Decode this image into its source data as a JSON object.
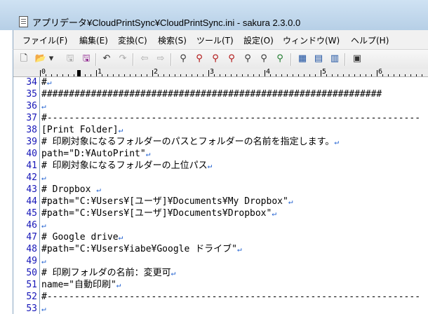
{
  "window": {
    "title": "アプリデータ¥CloudPrintSync¥CloudPrintSync.ini - sakura 2.3.0.0"
  },
  "menu": [
    {
      "label": "ファイル(F)"
    },
    {
      "label": "編集(E)"
    },
    {
      "label": "変換(C)"
    },
    {
      "label": "検索(S)"
    },
    {
      "label": "ツール(T)"
    },
    {
      "label": "設定(O)"
    },
    {
      "label": "ウィンドウ(W)"
    },
    {
      "label": "ヘルプ(H)"
    }
  ],
  "toolbar": {
    "buttons": [
      {
        "icon": "new-file-icon",
        "glyph": "🗋"
      },
      {
        "icon": "open-folder-icon",
        "glyph": "📂"
      },
      {
        "icon": "dropdown-arrow-icon",
        "glyph": "▾"
      },
      {
        "icon": "save-icon",
        "glyph": "🖫"
      },
      {
        "icon": "save-as-icon",
        "glyph": "🖫"
      },
      {
        "icon": "undo-icon",
        "glyph": "↶"
      },
      {
        "icon": "redo-icon",
        "glyph": "↷"
      },
      {
        "icon": "back-icon",
        "glyph": "⇦"
      },
      {
        "icon": "forward-icon",
        "glyph": "⇨"
      },
      {
        "icon": "search-icon",
        "glyph": "⚲"
      },
      {
        "icon": "search-down-icon",
        "glyph": "⚲"
      },
      {
        "icon": "search-up-icon",
        "glyph": "⚲"
      },
      {
        "icon": "replace-icon",
        "glyph": "⚲"
      },
      {
        "icon": "clear-mark-icon",
        "glyph": "⚲"
      },
      {
        "icon": "grep-icon",
        "glyph": "⚲"
      },
      {
        "icon": "tag-jump-icon",
        "glyph": "⚲"
      },
      {
        "icon": "compare-icon",
        "glyph": "▦"
      },
      {
        "icon": "outline-icon",
        "glyph": "▤"
      },
      {
        "icon": "split-icon",
        "glyph": "▥"
      },
      {
        "icon": "settings-icon",
        "glyph": "▣"
      }
    ]
  },
  "ruler": {
    "labels": [
      "0",
      "1",
      "2",
      "3",
      "4",
      "5",
      "6"
    ]
  },
  "editor": {
    "eol_glyph": "↵",
    "lines": [
      {
        "no": "34",
        "text": "#"
      },
      {
        "no": "35",
        "text": "##############################################################"
      },
      {
        "no": "36",
        "text": ""
      },
      {
        "no": "37",
        "text": "#--------------------------------------------------------------------"
      },
      {
        "no": "38",
        "text": "[Print Folder]"
      },
      {
        "no": "39",
        "text": "# 印刷対象になるフォルダーのパスとフォルダーの名前を指定します。"
      },
      {
        "no": "40",
        "text": "path=\"D:¥AutoPrint\""
      },
      {
        "no": "41",
        "text": "# 印刷対象になるフォルダーの上位パス"
      },
      {
        "no": "42",
        "text": ""
      },
      {
        "no": "43",
        "text": "# Dropbox "
      },
      {
        "no": "44",
        "text": "#path=\"C:¥Users¥[ユーザ]¥Documents¥My Dropbox\""
      },
      {
        "no": "45",
        "text": "#path=\"C:¥Users¥[ユーザ]¥Documents¥Dropbox\""
      },
      {
        "no": "46",
        "text": ""
      },
      {
        "no": "47",
        "text": "# Google drive"
      },
      {
        "no": "48",
        "text": "#path=\"C:¥Users¥iabe¥Google ドライブ\""
      },
      {
        "no": "49",
        "text": ""
      },
      {
        "no": "50",
        "text": "# 印刷フォルダの名前：変更可"
      },
      {
        "no": "51",
        "text": "name=\"自動印刷\""
      },
      {
        "no": "52",
        "text": "#--------------------------------------------------------------------"
      },
      {
        "no": "53",
        "text": ""
      }
    ]
  }
}
